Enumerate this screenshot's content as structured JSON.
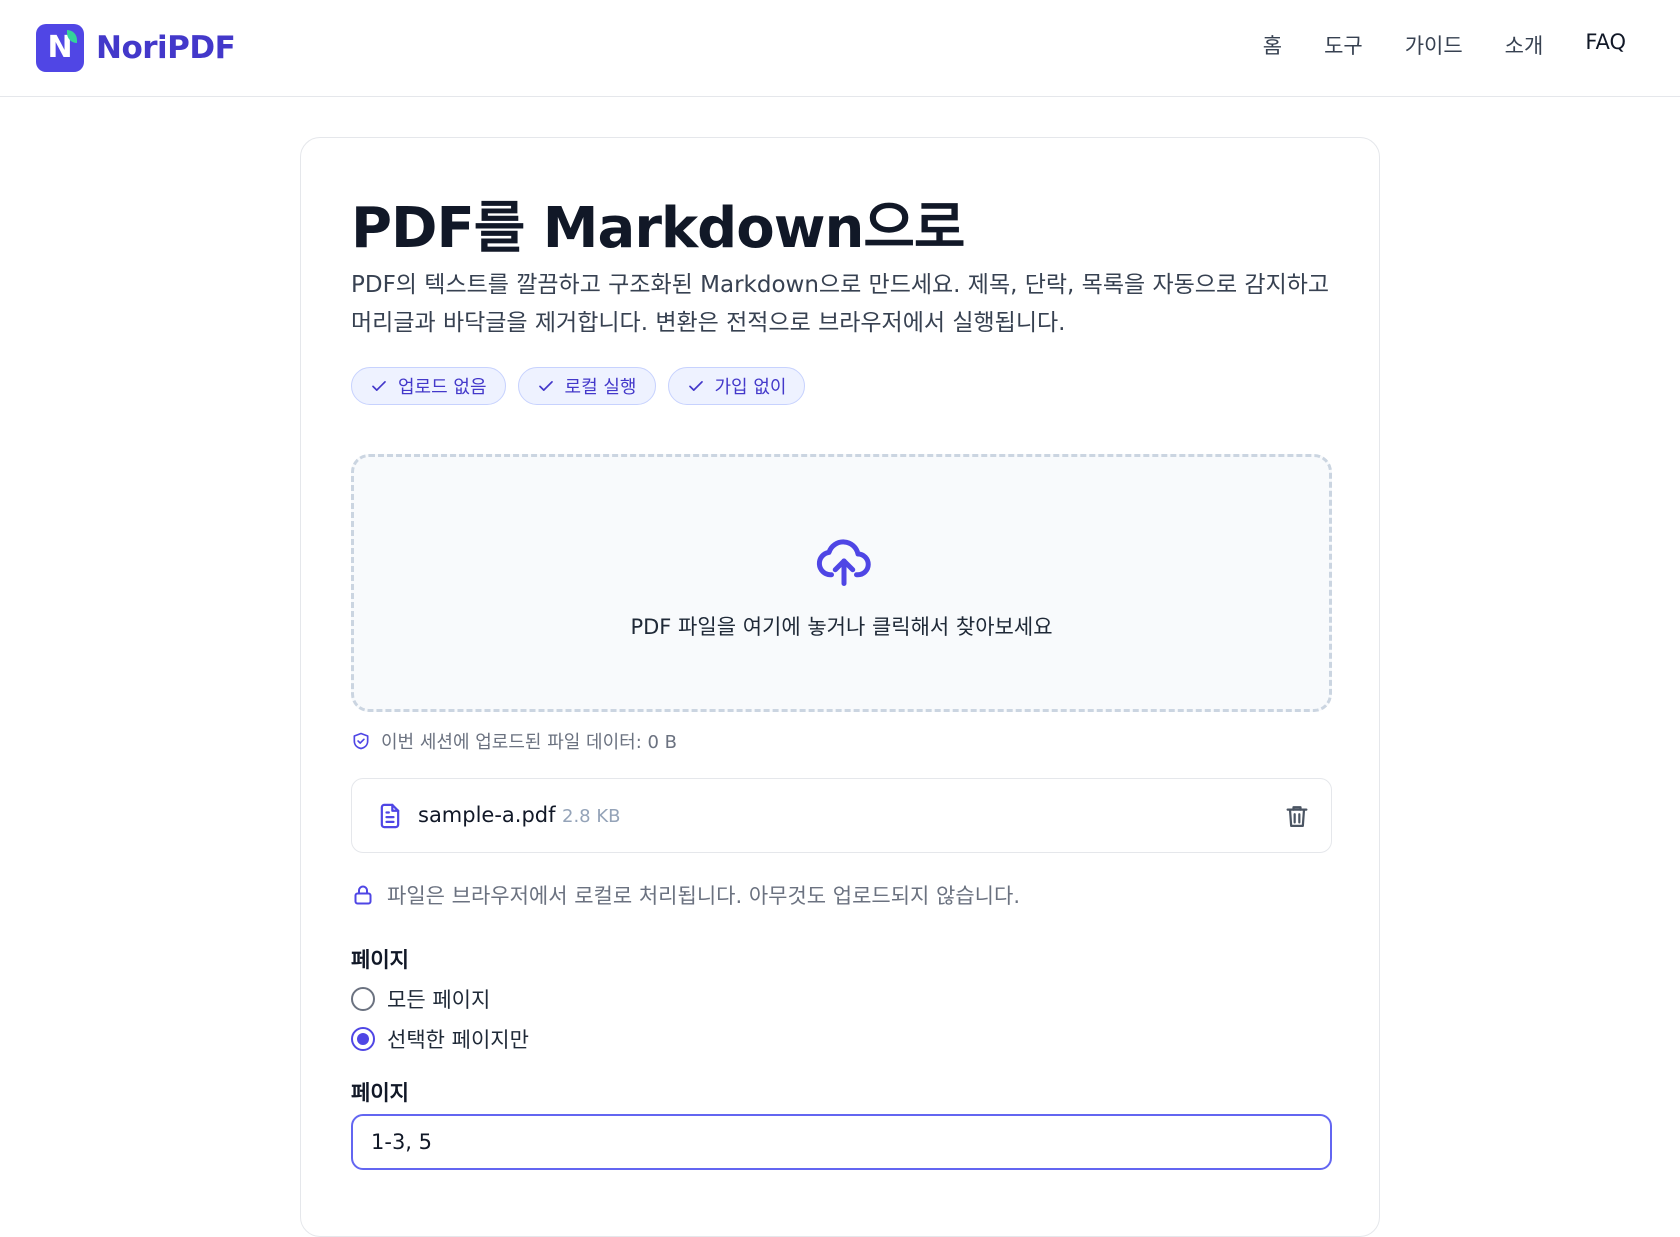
{
  "header": {
    "brand": "NoriPDF",
    "logo_letter": "N",
    "nav": [
      "홈",
      "도구",
      "가이드",
      "소개",
      "FAQ"
    ]
  },
  "main": {
    "title": "PDF를 Markdown으로",
    "description": "PDF의 텍스트를 깔끔하고 구조화된 Markdown으로 만드세요. 제목, 단락, 목록을 자동으로 감지하고 머리글과 바닥글을 제거합니다. 변환은 전적으로 브라우저에서 실행됩니다.",
    "chips": [
      "업로드 없음",
      "로컬 실행",
      "가입 없이"
    ],
    "dropzone_text": "PDF 파일을 여기에 놓거나 클릭해서 찾아보세요",
    "session_info": "이번 세션에 업로드된 파일 데이터: 0 B",
    "file": {
      "name": "sample-a.pdf",
      "size": "2.8 KB"
    },
    "local_note": "파일은 브라우저에서 로컬로 처리됩니다. 아무것도 업로드되지 않습니다.",
    "pages_label": "페이지",
    "radio_all": "모든 페이지",
    "radio_selected": "선택한 페이지만",
    "pages_input_label": "페이지",
    "pages_input_value": "1-3, 5"
  },
  "colors": {
    "accent": "#4f46e5",
    "brand": "#4338ca",
    "chip_bg": "#eef2ff",
    "leaf": "#34d399"
  }
}
